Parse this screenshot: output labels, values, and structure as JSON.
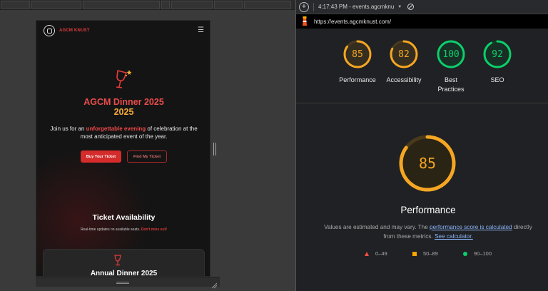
{
  "site": {
    "name": "AGCM KNUST",
    "hero_title_1": "AGCM Dinner 2025",
    "hero_title_2": "2025",
    "hero_sub_pre": "Join us for an ",
    "hero_sub_highlight": "unforgettable evening",
    "hero_sub_post": " of celebration at the most anticipated event of the year.",
    "buy_label": "Buy Your Ticket",
    "find_label": "Find My Ticket",
    "avail_title": "Ticket Availability",
    "avail_sub_pre": "Real-time updates on available seats. ",
    "avail_sub_highlight": "Don't miss out!",
    "card_title": "Annual Dinner 2025"
  },
  "lighthouse": {
    "timestamp": "4:17:43 PM - events.agcmknu",
    "url": "https://events.agcmknust.com/",
    "scores": [
      {
        "label": "Performance",
        "value": "85",
        "fraction": 0.85,
        "color": "#f5a623",
        "track": "#4a3a1c"
      },
      {
        "label": "Accessibility",
        "value": "82",
        "fraction": 0.82,
        "color": "#f5a623",
        "track": "#4a3a1c"
      },
      {
        "label": "Best Practices",
        "value": "100",
        "fraction": 1.0,
        "color": "#0cce6b",
        "track": "#0f3d26"
      },
      {
        "label": "SEO",
        "value": "92",
        "fraction": 0.92,
        "color": "#0cce6b",
        "track": "#0f3d26"
      }
    ],
    "main_score": {
      "label": "Performance",
      "value": "85",
      "fraction": 0.85,
      "color": "#f5a623"
    },
    "note_1": "Values are estimated and may vary. The ",
    "note_link_1": "performance score is calculated",
    "note_2": " directly from these metrics. ",
    "note_link_2": "See calculator.",
    "legend": [
      {
        "label": "0–49",
        "shape": "triangle",
        "color": "#ff4e42"
      },
      {
        "label": "50–89",
        "shape": "square",
        "color": "#ffa400"
      },
      {
        "label": "90–100",
        "shape": "circle",
        "color": "#0cce6b"
      }
    ]
  }
}
